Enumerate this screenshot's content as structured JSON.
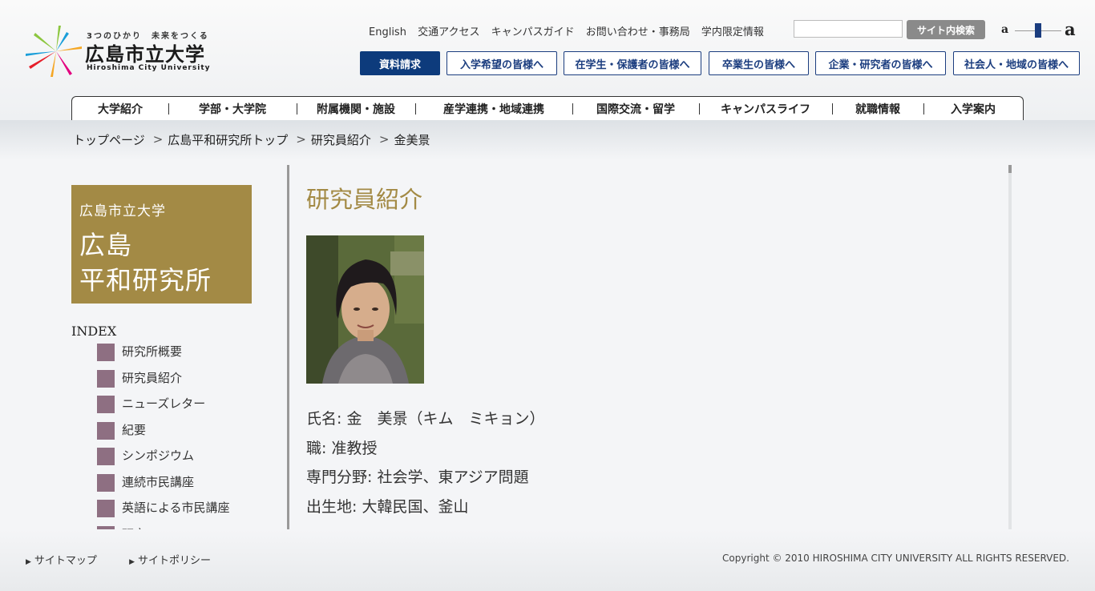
{
  "header": {
    "logo": {
      "tagline": "3つのひかり　未来をつくる",
      "name_jp": "広島市立大学",
      "name_en": "Hiroshima City University"
    },
    "top_links": [
      "English",
      "交通アクセス",
      "キャンパスガイド",
      "お問い合わせ・事務局",
      "学内限定情報"
    ],
    "search": {
      "placeholder": "",
      "button_label": "サイト内検索"
    },
    "font_size": {
      "small_label": "a",
      "large_label": "a",
      "level": 0.5
    },
    "audience_nav": [
      "資料請求",
      "入学希望の皆様へ",
      "在学生・保護者の皆様へ",
      "卒業生の皆様へ",
      "企業・研究者の皆様へ",
      "社会人・地域の皆様へ"
    ],
    "global_nav": [
      "大学紹介",
      "学部・大学院",
      "附属機関・施設",
      "産学連携・地域連携",
      "国際交流・留学",
      "キャンパスライフ",
      "就職情報",
      "入学案内"
    ]
  },
  "breadcrumb": [
    "トップページ",
    "広島平和研究所トップ",
    "研究員紹介",
    "金美景"
  ],
  "breadcrumb_separator": ">",
  "sidebar": {
    "banner": {
      "line1": "広島市立大学",
      "line2": "広島",
      "line3": "平和研究所"
    },
    "index_heading": "INDEX",
    "index_items": [
      "研究所概要",
      "研究員紹介",
      "ニューズレター",
      "紀要",
      "シンポジウム",
      "連続市民講座",
      "英語による市民講座",
      "研究"
    ]
  },
  "main": {
    "title": "研究員紹介",
    "profile": [
      "氏名: 金　美景（キム　ミキョン）",
      "職: 准教授",
      "専門分野: 社会学、東アジア問題",
      "出生地: 大韓民国、釜山"
    ]
  },
  "footer": {
    "links": [
      "サイトマップ",
      "サイトポリシー"
    ],
    "copyright": "Copyright © 2010 HIROSHIMA CITY UNIVERSITY ALL RIGHTS RESERVED."
  },
  "colors": {
    "navy": "#0d3b7c",
    "gold": "#a38a45",
    "index_square": "#8e6f82"
  }
}
